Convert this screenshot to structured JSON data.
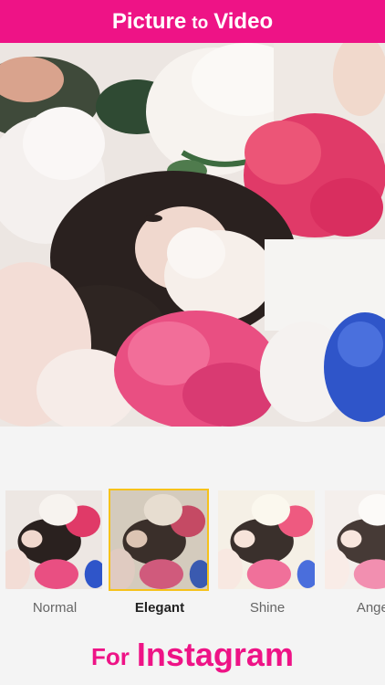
{
  "header": {
    "title_part1": "Picture",
    "title_part2": "to",
    "title_part3": "Video",
    "background_color": "#ee1386"
  },
  "filters": {
    "selected_index": 1,
    "items": [
      {
        "label": "Normal"
      },
      {
        "label": "Elegant"
      },
      {
        "label": "Shine"
      },
      {
        "label": "Angel"
      }
    ]
  },
  "footer": {
    "tagline_part1": "For",
    "tagline_part2": "Instagram"
  }
}
